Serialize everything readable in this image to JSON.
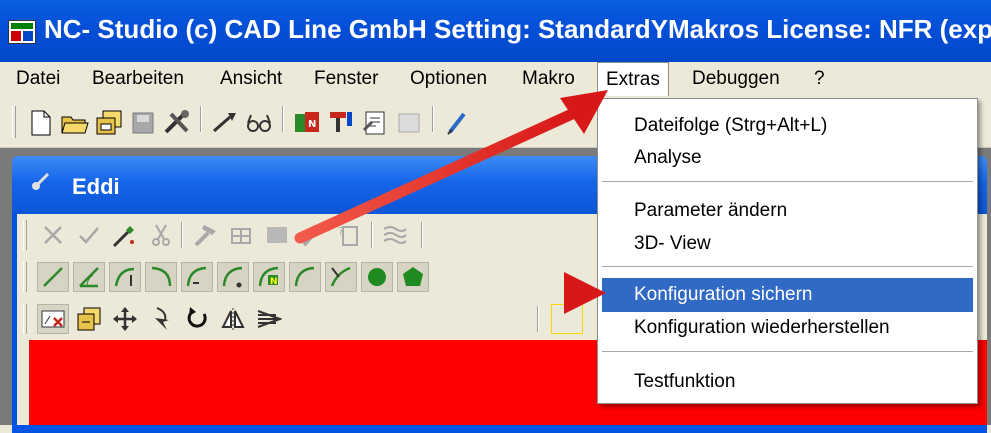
{
  "window": {
    "title": "NC- Studio (c) CAD Line GmbH Setting: StandardYMakros License: NFR (expe"
  },
  "menubar": {
    "items": [
      "Datei",
      "Bearbeiten",
      "Ansicht",
      "Fenster",
      "Optionen",
      "Makro",
      "Extras",
      "Debuggen",
      "?"
    ],
    "active": "Extras"
  },
  "child_window": {
    "title": "Eddi"
  },
  "extras_menu": {
    "items": [
      {
        "label": "Dateifolge (Strg+Alt+L)",
        "highlighted": false
      },
      {
        "label": "Analyse",
        "highlighted": false
      },
      {
        "label": "Parameter ändern",
        "highlighted": false
      },
      {
        "label": "3D- View",
        "highlighted": false
      },
      {
        "label": "Konfiguration sichern",
        "highlighted": true
      },
      {
        "label": "Konfiguration wiederherstellen",
        "highlighted": false
      },
      {
        "label": "Testfunktion",
        "highlighted": false
      }
    ]
  },
  "colors": {
    "titlebar": "#0550d8",
    "highlight": "#316ac5",
    "annotation_arrow": "#e52a2a",
    "drawing_area": "#fe0000"
  },
  "icons": {
    "toolbar": [
      "new-file-icon",
      "open-folder-icon",
      "save-all-icon",
      "save-icon",
      "tools-icon",
      "brush-icon",
      "glasses-icon",
      "nc-red-icon",
      "pin-icon",
      "properties-icon",
      "disabled-icon",
      "pen-icon"
    ],
    "eddi_row1": [
      "cancel-x-icon",
      "check-icon",
      "wand-icon",
      "cut-icon",
      "hammer-icon",
      "grid-help-icon",
      "block-icon",
      "wand2-icon",
      "help-doc-icon",
      "waves-icon"
    ],
    "eddi_row2": [
      "line-icon",
      "angle-line-icon",
      "arc-cw-icon",
      "arc-ccw-icon",
      "arc-icon",
      "arc-down-icon",
      "arc-n-icon",
      "arc-small-icon",
      "corner-icon",
      "circle-green-icon",
      "polygon-green-icon"
    ],
    "eddi_row3": [
      "delete-red-icon",
      "copy-icon",
      "move-icon",
      "rotate-cursor-icon",
      "rotate-icon",
      "mirror-icon",
      "hatch-icon"
    ]
  }
}
